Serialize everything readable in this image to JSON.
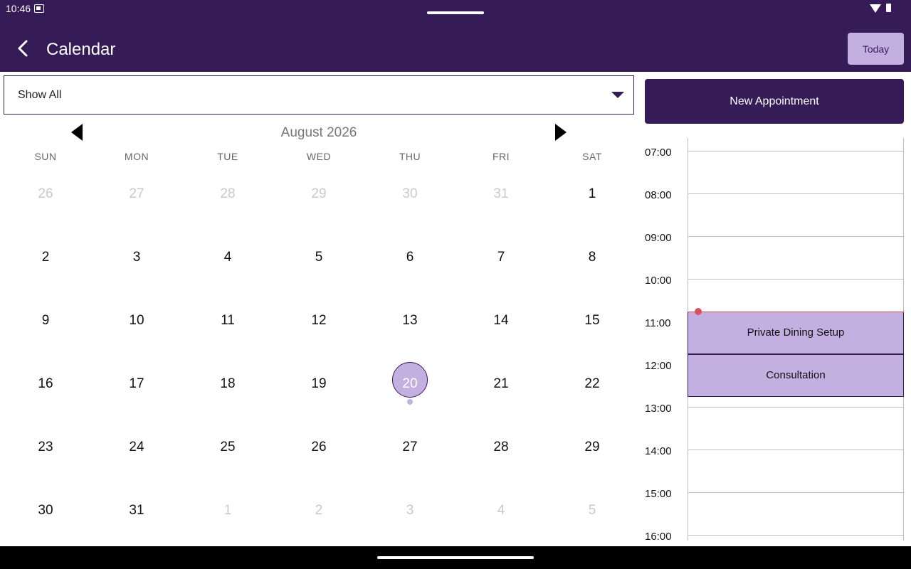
{
  "status_bar": {
    "time": "10:46"
  },
  "app_bar": {
    "title": "Calendar",
    "today_label": "Today"
  },
  "filter": {
    "selected": "Show All"
  },
  "new_appointment_label": "New Appointment",
  "calendar": {
    "month_label": "August 2026",
    "weekdays": [
      "SUN",
      "MON",
      "TUE",
      "WED",
      "THU",
      "FRI",
      "SAT"
    ],
    "weeks": [
      [
        {
          "d": "26",
          "o": true
        },
        {
          "d": "27",
          "o": true
        },
        {
          "d": "28",
          "o": true
        },
        {
          "d": "29",
          "o": true
        },
        {
          "d": "30",
          "o": true
        },
        {
          "d": "31",
          "o": true
        },
        {
          "d": "1"
        }
      ],
      [
        {
          "d": "2"
        },
        {
          "d": "3"
        },
        {
          "d": "4"
        },
        {
          "d": "5"
        },
        {
          "d": "6"
        },
        {
          "d": "7"
        },
        {
          "d": "8"
        }
      ],
      [
        {
          "d": "9"
        },
        {
          "d": "10"
        },
        {
          "d": "11"
        },
        {
          "d": "12"
        },
        {
          "d": "13"
        },
        {
          "d": "14"
        },
        {
          "d": "15"
        }
      ],
      [
        {
          "d": "16"
        },
        {
          "d": "17"
        },
        {
          "d": "18"
        },
        {
          "d": "19"
        },
        {
          "d": "20",
          "selected": true,
          "has_event": true
        },
        {
          "d": "21"
        },
        {
          "d": "22"
        }
      ],
      [
        {
          "d": "23"
        },
        {
          "d": "24"
        },
        {
          "d": "25"
        },
        {
          "d": "26"
        },
        {
          "d": "27"
        },
        {
          "d": "28"
        },
        {
          "d": "29"
        }
      ],
      [
        {
          "d": "30"
        },
        {
          "d": "31"
        },
        {
          "d": "1",
          "o": true
        },
        {
          "d": "2",
          "o": true
        },
        {
          "d": "3",
          "o": true
        },
        {
          "d": "4",
          "o": true
        },
        {
          "d": "5",
          "o": true
        }
      ]
    ]
  },
  "schedule": {
    "hours": [
      "07:00",
      "08:00",
      "09:00",
      "10:00",
      "11:00",
      "12:00",
      "13:00",
      "14:00",
      "15:00",
      "16:00"
    ],
    "current_time": "10:46",
    "appointments": [
      {
        "title": "Private Dining Setup",
        "start": "10:46"
      },
      {
        "title": "Consultation",
        "start": "11:46"
      }
    ]
  },
  "colors": {
    "primary": "#361c57",
    "accent": "#c4b0e0",
    "now_indicator": "#d9535f"
  }
}
